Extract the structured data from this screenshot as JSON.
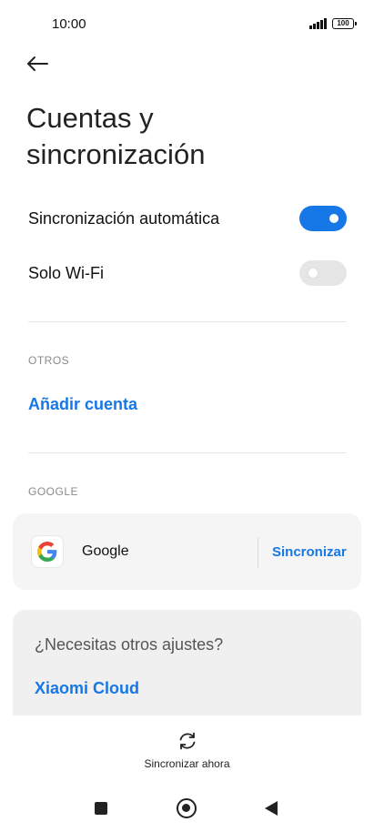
{
  "status_bar": {
    "time": "10:00",
    "battery": "100"
  },
  "page": {
    "title_line1": "Cuentas y",
    "title_line2": "sincronización"
  },
  "settings": {
    "auto_sync_label": "Sincronización automática",
    "auto_sync_on": true,
    "wifi_only_label": "Solo Wi-Fi",
    "wifi_only_on": false
  },
  "others": {
    "header": "OTROS",
    "add_account": "Añadir cuenta"
  },
  "google": {
    "header": "GOOGLE",
    "account_name": "Google",
    "sync_button": "Sincronizar"
  },
  "more_settings": {
    "title": "¿Necesitas otros ajustes?",
    "link": "Xiaomi Cloud"
  },
  "bottom": {
    "sync_now": "Sincronizar ahora"
  },
  "colors": {
    "accent": "#1677e6",
    "toggle_off": "#e6e6e6",
    "card_bg": "#f5f5f5"
  },
  "icons": [
    "back-arrow-icon",
    "google-icon",
    "sync-icon",
    "signal-icon",
    "battery-icon"
  ]
}
